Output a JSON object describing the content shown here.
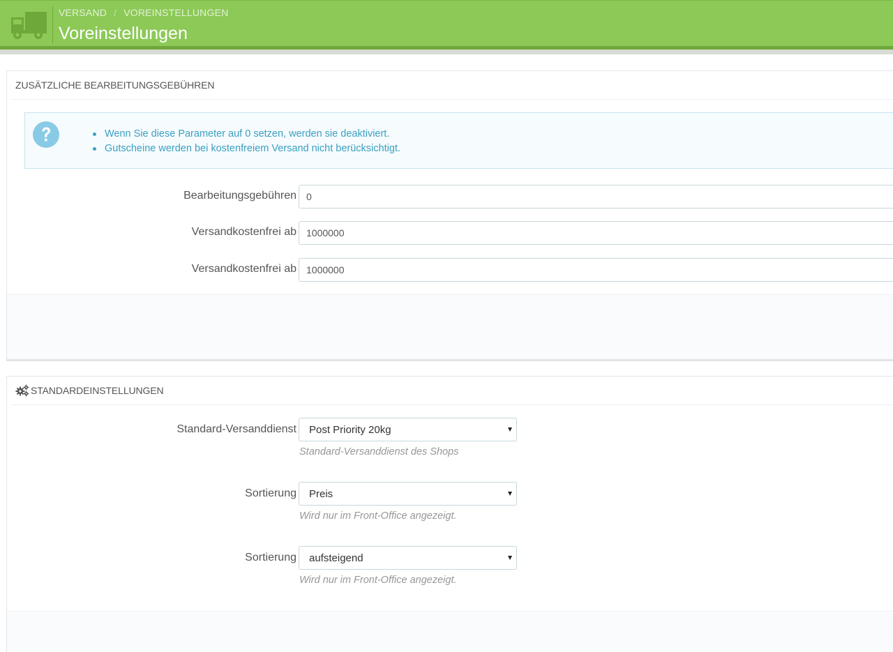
{
  "header": {
    "breadcrumb": [
      "VERSAND",
      "VOREINSTELLUNGEN"
    ],
    "breadcrumb_separator": "/",
    "title": "Voreinstellungen",
    "icon": "truck-icon",
    "accent_color": "#8cc957"
  },
  "panel_fees": {
    "title": "ZUSÄTZLICHE BEARBEITUNGSGEBÜHREN",
    "info_icon": "question-circle-icon",
    "info_items": [
      "Wenn Sie diese Parameter auf 0 setzen, werden sie deaktiviert.",
      "Gutscheine werden bei kostenfreiem Versand nicht berücksichtigt."
    ],
    "fields": [
      {
        "label": "Bearbeitungsgebühren",
        "value": "0"
      },
      {
        "label": "Versandkostenfrei ab",
        "value": "1000000"
      },
      {
        "label": "Versandkostenfrei ab",
        "value": "1000000"
      }
    ]
  },
  "panel_defaults": {
    "title": "STANDARDEINSTELLUNGEN",
    "icon": "cogs-icon",
    "selects": [
      {
        "label": "Standard-Versanddienst",
        "value": "Post Priority 20kg",
        "help": "Standard-Versanddienst des Shops"
      },
      {
        "label": "Sortierung",
        "value": "Preis",
        "help": "Wird nur im Front-Office angezeigt."
      },
      {
        "label": "Sortierung",
        "value": "aufsteigend",
        "help": "Wird nur im Front-Office angezeigt."
      }
    ]
  }
}
